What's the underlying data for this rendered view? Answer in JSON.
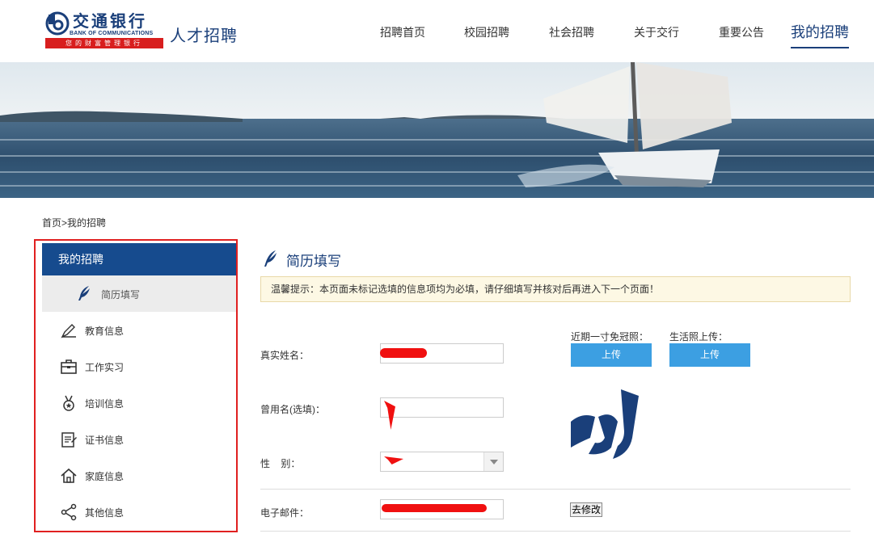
{
  "header": {
    "logo_cn": "交通银行",
    "logo_en": "BANK OF COMMUNICATIONS",
    "logo_slogan": "您的财富管理银行",
    "site_title": "人才招聘",
    "nav": [
      {
        "label": "招聘首页"
      },
      {
        "label": "校园招聘"
      },
      {
        "label": "社会招聘"
      },
      {
        "label": "关于交行"
      },
      {
        "label": "重要公告"
      },
      {
        "label": "我的招聘",
        "active": true
      }
    ]
  },
  "breadcrumb": "首页>我的招聘",
  "sidebar": {
    "head": "我的招聘",
    "sub": "简历填写",
    "items": [
      {
        "label": "教育信息",
        "icon": "pen-icon"
      },
      {
        "label": "工作实习",
        "icon": "briefcase-icon"
      },
      {
        "label": "培训信息",
        "icon": "medal-icon"
      },
      {
        "label": "证书信息",
        "icon": "certificate-icon"
      },
      {
        "label": "家庭信息",
        "icon": "home-icon"
      },
      {
        "label": "其他信息",
        "icon": "share-icon"
      }
    ]
  },
  "main": {
    "title": "简历填写",
    "notice": "温馨提示：本页面未标记选填的信息项均为必填，请仔细填写并核对后再进入下一个页面！",
    "fields": {
      "real_name_label": "真实姓名：",
      "former_name_label": "曾用名(选填)：",
      "gender_label": "性    别：",
      "email_label": "电子邮件："
    },
    "photo": {
      "id_photo_label": "近期一寸免冠照：",
      "life_photo_label": "生活照上传：",
      "upload_label": "上传",
      "modify_label": "去修改"
    }
  },
  "colors": {
    "brand_blue": "#164b8e",
    "upload_blue": "#3c9fe2",
    "highlight_red": "#e02020"
  }
}
